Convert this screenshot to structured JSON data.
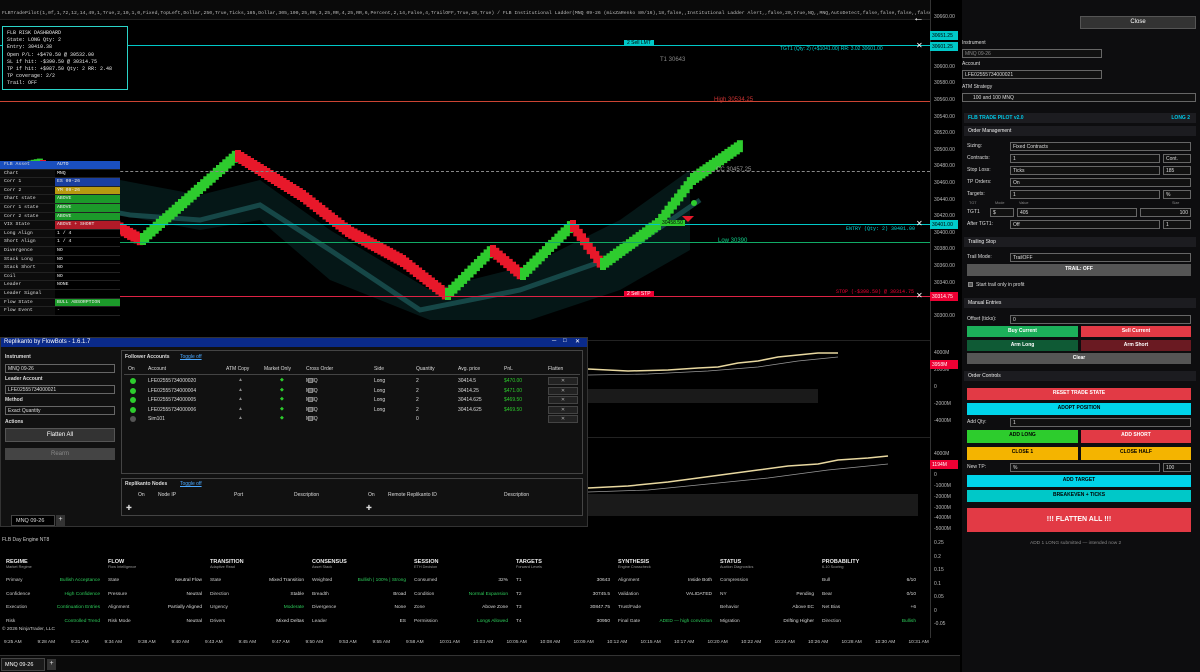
{
  "titlebar": "FLBTradePilot(1,0f,1,72,12,14,49,1,True,2,10,1,0,Fixed,TopLeft,Dollar,250,True,Ticks,185,Dollar,305,100,25,RR,3,25,RR,4,25,RR,6,Percent,2,14,False,4,TrailOFF,True,20,True) / FLB Institutional Ladder(MNQ 09-26 (mixZaRenko 80/16),18,false,,Institutional Ladder Alert,,false,20,true,NQ,,MNQ,AutoDetect,false,false,false,,false,,8,Alert,,50,50)",
  "risk": [
    "FLB RISK DASHBOARD",
    "State: LONG   Qty: 2",
    "Entry: 30410.38",
    "Open P/L: +$470.50 @ 30532.00",
    "SL if hit: -$390.50 @ 30314.75",
    "TP if hit: +$987.50  Qty: 2  RR: 2.48",
    "TP coverage: 2/2",
    "Trail: OFF"
  ],
  "chart_labels": {
    "sell_lmt": "2 Sell LMT",
    "tgt1": "TGT1  (Qty: 2)  (+$1041.00)  RR: 3.02  30601.00",
    "t1": "T1 30643",
    "high": "High 30534.25",
    "cc": "CC 30457.25",
    "low": "Low 30390",
    "entry": "ENTRY  (Qty: 2)  30401.00",
    "stop": "STOP  (-$398.50)  @ 30314.75",
    "sell_stp": "2 Sell STP",
    "green_tag": "30458.50"
  },
  "price_axis": [
    "30660.00",
    "30640.00",
    "30620.00",
    "30600.00",
    "30580.00",
    "30560.00",
    "30540.00",
    "30520.00",
    "30500.00",
    "30480.00",
    "30460.00",
    "30440.00",
    "30420.00",
    "30400.00",
    "30380.00",
    "30360.00",
    "30340.00",
    "30320.00",
    "30300.00"
  ],
  "axis_tags": {
    "tgt": "30601.25",
    "last": "30532.00",
    "entry": "30401.00",
    "stop": "30314.75",
    "top1": "30651.25"
  },
  "asset_panel": [
    [
      "FLB Asset",
      "AUTO"
    ],
    [
      "Chart",
      "MNQ"
    ],
    [
      "Corr 1",
      "ES 09-26"
    ],
    [
      "Corr 2",
      "YM 09-26"
    ],
    [
      "Chart state",
      "ABOVE"
    ],
    [
      "Corr 1 state",
      "ABOVE"
    ],
    [
      "Corr 2 state",
      "ABOVE"
    ],
    [
      "VIX State",
      "ABOVE + SHORT"
    ],
    [
      "Long Align",
      "1 / 4"
    ],
    [
      "Short Align",
      "1 / 4"
    ],
    [
      "Divergence",
      "NO"
    ],
    [
      "Stack Long",
      "NO"
    ],
    [
      "Stack Short",
      "NO"
    ],
    [
      "Coil",
      "NO"
    ],
    [
      "Leader",
      "NONE"
    ],
    [
      "Leader Signal",
      ""
    ],
    [
      "Flow State",
      "BULL ABSORPTION"
    ],
    [
      "Flow Event",
      "-"
    ]
  ],
  "repl": {
    "title": "Replikanto by FlowBots - 1.6.1.7",
    "instrument_label": "Instrument",
    "instrument": "MNQ 09-26",
    "leader_label": "Leader Account",
    "leader": "LFE02555734000021",
    "method_label": "Method",
    "method": "Exact Quantity",
    "actions_label": "Actions",
    "flatten": "Flatten All",
    "rearm": "Rearm",
    "followers_label": "Follower Accounts",
    "toggle": "Toggle off",
    "cols": [
      "On",
      "Account",
      "ATM Copy",
      "Market Only",
      "Cross Order",
      "Side",
      "Quantity",
      "Avg. price",
      "PnL",
      "Flatten"
    ],
    "rows": [
      [
        "LFE02555734000020",
        "MNQ",
        "Long",
        "2",
        "30414.5",
        "$470.00"
      ],
      [
        "LFE02555734000004",
        "MNQ",
        "Long",
        "2",
        "30414.25",
        "$471.00"
      ],
      [
        "LFE02555734000005",
        "MNQ",
        "Long",
        "2",
        "30414.625",
        "$469.50"
      ],
      [
        "LFE02555734000006",
        "MNQ",
        "Long",
        "2",
        "30414.625",
        "$469.50"
      ],
      [
        "Sim101",
        "MNQ",
        "",
        "0",
        "",
        ""
      ]
    ],
    "nodes_label": "Replikanto Nodes",
    "nodes_toggle": "Toggle off",
    "nodes_cols": [
      "On",
      "Node IP",
      "Port",
      "Description",
      "On",
      "Remote Replikanto ID",
      "Description"
    ],
    "tab": "MNQ 09-26"
  },
  "mini_axis_1": [
    "4000M",
    "2000M",
    "0",
    "-2000M",
    "-4000M"
  ],
  "mini_axis_2": [
    "4000M",
    "2000M",
    "0",
    "-1000M",
    "-2000M",
    "-3000M",
    "-4000M",
    "-5000M",
    "-6000M"
  ],
  "mini_tags": {
    "a": "3958M",
    "b": "1194M"
  },
  "engine_axis": [
    "0.25",
    "0.2",
    "0.15",
    "0.1",
    "0.05",
    "0",
    "-0.05"
  ],
  "engine": {
    "title": "FLB Day Engine NT8",
    "cols": [
      {
        "h": "REGIME",
        "s": "Market Regime",
        "rows": [
          [
            "Primary",
            "Bullish Acceptance"
          ],
          [
            "Confidence",
            "High Confidence"
          ],
          [
            "Execution",
            "Continuation Entries"
          ],
          [
            "Risk",
            "Controlled Trend"
          ]
        ]
      },
      {
        "h": "FLOW",
        "s": "Flow Intelligence",
        "rows": [
          [
            "State",
            "Neutral Flow"
          ],
          [
            "Pressure",
            "Neutral"
          ],
          [
            "Alignment",
            "Partially Aligned"
          ],
          [
            "Risk Mode",
            "Neutral"
          ]
        ]
      },
      {
        "h": "TRANSITION",
        "s": "Adaptive Read",
        "rows": [
          [
            "State",
            "Mixed Transition"
          ],
          [
            "Direction",
            "Stable"
          ],
          [
            "Urgency",
            "Moderate"
          ],
          [
            "Drivers",
            "Mixed Deltas"
          ]
        ]
      },
      {
        "h": "CONSENSUS",
        "s": "Asset Stack",
        "rows": [
          [
            "Weighted",
            "Bullish | 100% | Strong"
          ],
          [
            "Breadth",
            "Broad"
          ],
          [
            "Divergence",
            "None"
          ],
          [
            "Leader",
            "ES"
          ]
        ]
      },
      {
        "h": "SESSION",
        "s": "ETH Decision",
        "rows": [
          [
            "Consumed",
            "32%"
          ],
          [
            "Condition",
            "Normal Expansion"
          ],
          [
            "Zone",
            "Above Zone"
          ],
          [
            "Permission",
            "Longs Allowed"
          ]
        ]
      },
      {
        "h": "TARGETS",
        "s": "Forward Levels",
        "rows": [
          [
            "T1",
            "30643"
          ],
          [
            "T2",
            "30745.5"
          ],
          [
            "T3",
            "30847.75"
          ],
          [
            "T4",
            "30950"
          ]
        ]
      },
      {
        "h": "SYNTHESIS",
        "s": "Engine Crosscheck",
        "rows": [
          [
            "Alignment",
            "Inside Both"
          ],
          [
            "Validation",
            "VALIDATED"
          ],
          [
            "Trust/Fade",
            ""
          ],
          [
            "Final Gate",
            "ADED — high conviction"
          ]
        ]
      },
      {
        "h": "STATUS",
        "s": "Auction Diagnostics",
        "rows": [
          [
            "Compression",
            ""
          ],
          [
            "NY",
            "Pending"
          ],
          [
            "Behavior",
            "Above EC"
          ],
          [
            "Migration",
            "Drifting Higher"
          ]
        ]
      },
      {
        "h": "PROBABILITY",
        "s": "6-10 Scoring",
        "rows": [
          [
            "Bull",
            "6/10"
          ],
          [
            "Bear",
            "0/10"
          ],
          [
            "Net Bias",
            "+6"
          ],
          [
            "Direction",
            "Bullish"
          ]
        ]
      }
    ]
  },
  "copyright": "© 2026 NinjaTrader, LLC",
  "times": [
    "9:25 AM",
    "9:28 AM",
    "9:31 AM",
    "9:34 AM",
    "9:38 AM",
    "9:40 AM",
    "9:43 AM",
    "9:45 AM",
    "9:47 AM",
    "9:50 AM",
    "9:53 AM",
    "9:55 AM",
    "9:58 AM",
    "10:01 AM",
    "10:03 AM",
    "10:05 AM",
    "10:08 AM",
    "10:09 AM",
    "10:12 AM",
    "10:15 AM",
    "10:17 AM",
    "10:20 AM",
    "10:22 AM",
    "10:24 AM",
    "10:26 AM",
    "10:28 AM",
    "10:30 AM",
    "10:31 AM"
  ],
  "bottom_tab": "MNQ 09-26",
  "right": {
    "close": "Close",
    "instrument_label": "Instrument",
    "instrument": "MNQ 09-26",
    "account_label": "Account",
    "account": "LFE02555734000021",
    "atm_label": "ATM Strategy",
    "atm": "100 and 100 MNQ",
    "pilot": "FLB TRADE PILOT v2.0",
    "pilot_state": "LONG 2",
    "order_mgmt": "Order Management",
    "sizing_label": "Sizing:",
    "sizing": "Fixed Contracts",
    "contracts_label": "Contracts:",
    "contracts": "1",
    "contracts_unit": "Cont.",
    "stop_label": "Stop Loss:",
    "stop_mode": "Ticks",
    "stop_val": "185",
    "tp_orders_label": "TP Orders:",
    "tp_orders": "On",
    "targets_label": "Targets:",
    "targets": "1",
    "targets_unit": "%",
    "tgt_hdr": [
      "TGT",
      "Mode",
      "Value",
      "Size"
    ],
    "tgt1_label": "TGT1",
    "tgt1_mode": "$",
    "tgt1_value": "405",
    "tgt1_size": "100",
    "after_label": "After TGT1:",
    "after": "Off",
    "after_val": "1",
    "trailing": "Trailing Stop",
    "trail_mode_label": "Trail Mode:",
    "trail_mode": "TrailOFF",
    "trail_btn": "TRAIL: OFF",
    "trail_check": "Start trail only in profit",
    "manual": "Manual Entries",
    "offset_label": "Offset (ticks):",
    "offset": "0",
    "buy": "Buy Current",
    "sell": "Sell Current",
    "arm_long": "Arm Long",
    "arm_short": "Arm Short",
    "clear": "Clear",
    "order_controls": "Order Controls",
    "reset": "RESET TRADE STATE",
    "adopt": "ADOPT POSITION",
    "add_qty_label": "Add Qty:",
    "add_qty": "1",
    "add_long": "ADD LONG",
    "add_short": "ADD SHORT",
    "close1": "CLOSE 1",
    "close_half": "CLOSE HALF",
    "newtp_label": "New TP:",
    "newtp_mode": "%",
    "newtp_val": "100",
    "add_target": "ADD TARGET",
    "breakeven": "BREAKEVEN + TICKS",
    "flatten": "!!!  FLATTEN ALL  !!!",
    "status": "ADD 1 LONG submitted — intended now 2"
  },
  "colors": {
    "bull": "#2ecc2e",
    "bear": "#e8182a",
    "accent": "#00c8e6",
    "panel": "#0d0d0f"
  },
  "chart_data": {
    "type": "bar",
    "title": "",
    "x": [],
    "series": [],
    "note_visible_levels": {
      "tgt1": 30601.0,
      "high": 30534.25,
      "cc": 30457.25,
      "entry": 30401.0,
      "low": 30390,
      "stop": 30314.75
    },
    "ylim": [
      30300,
      30660
    ]
  }
}
